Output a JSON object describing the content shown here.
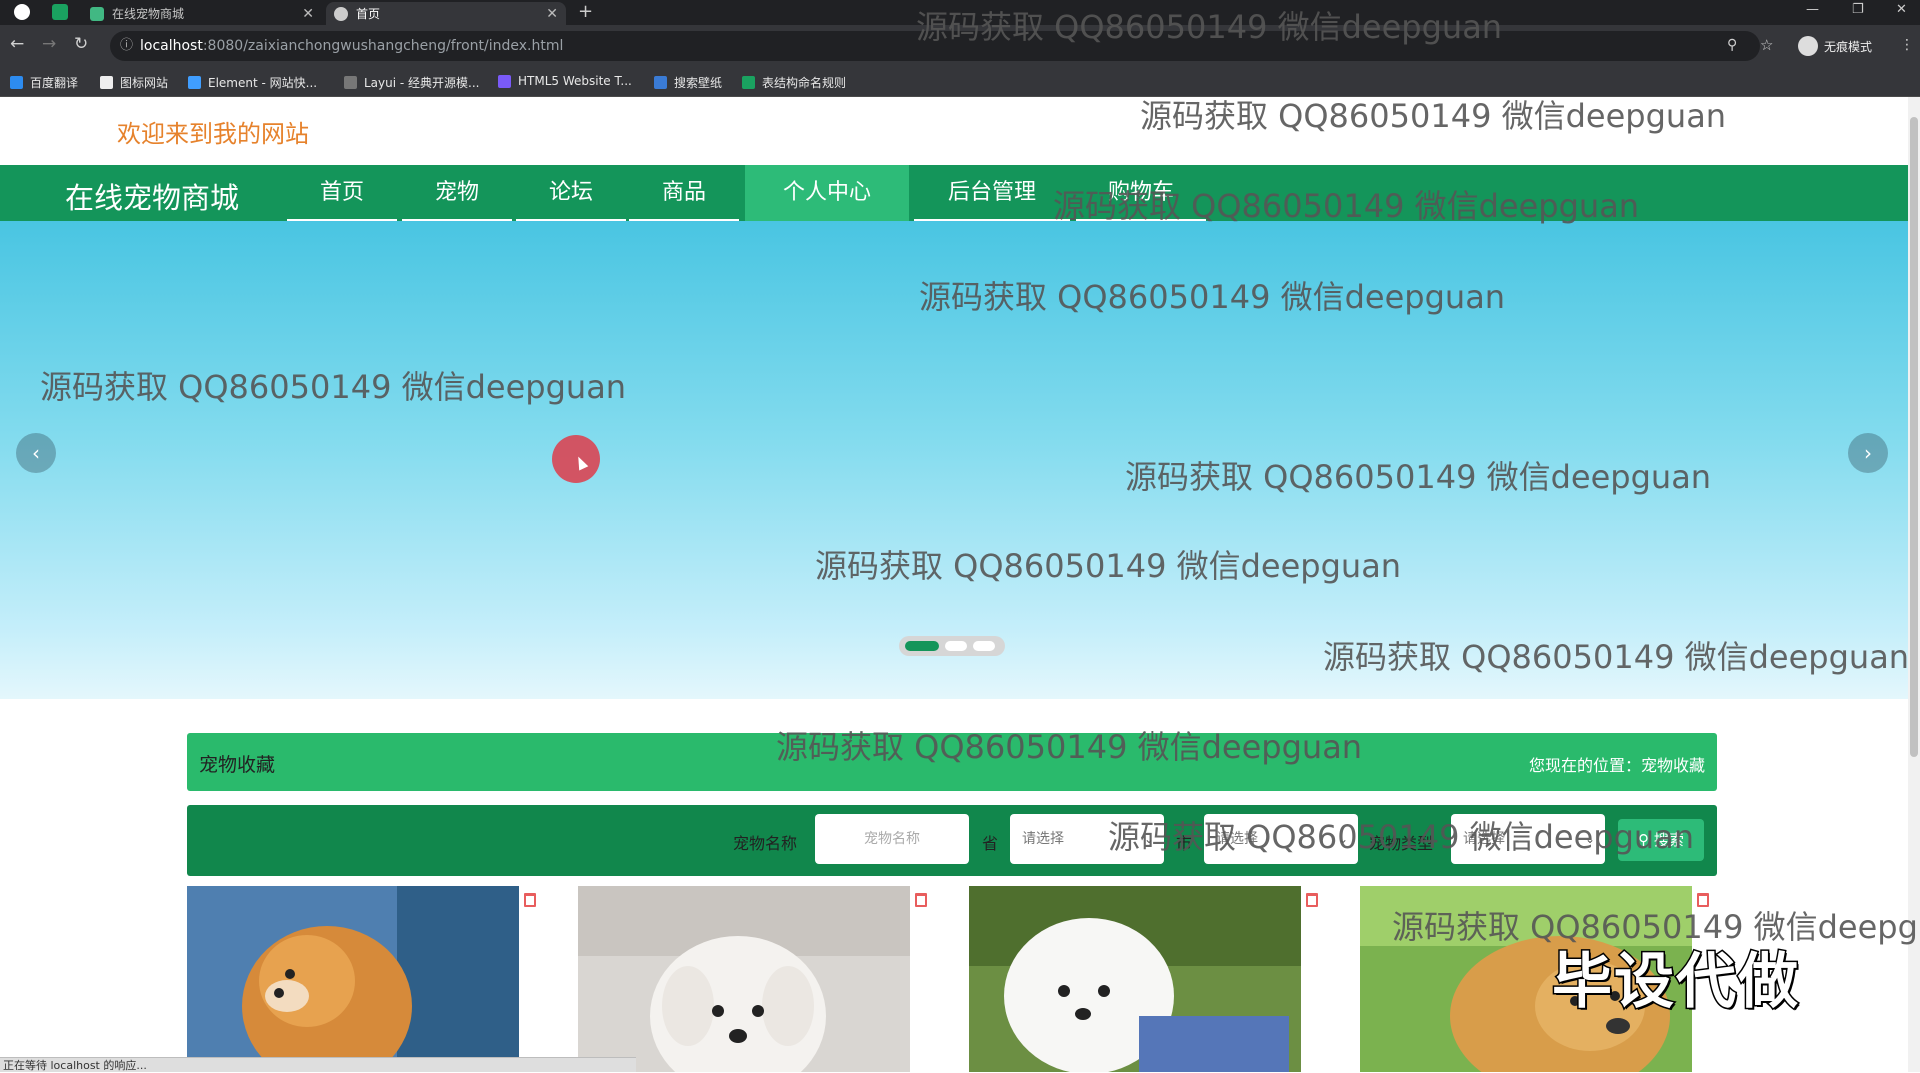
{
  "browser": {
    "tabs": [
      {
        "title": "在线宠物商城",
        "favicon": "vue-logo-icon"
      },
      {
        "title": "首页",
        "favicon": "globe-icon"
      }
    ],
    "url_host": "localhost",
    "url_path": ":8080/zaixianchongwushangcheng/front/index.html",
    "incognito_label": "无痕模式",
    "bookmarks": [
      "百度翻译",
      "图标网站",
      "Element - 网站快...",
      "Layui - 经典开源模...",
      "HTML5 Website T...",
      "搜索壁纸",
      "表结构命名规则"
    ]
  },
  "site": {
    "welcome": "欢迎来到我的网站",
    "brand": "在线宠物商城",
    "nav": [
      "首页",
      "宠物",
      "论坛",
      "商品",
      "个人中心",
      "后台管理",
      "购物车"
    ],
    "active_nav": "个人中心"
  },
  "section": {
    "title": "宠物收藏",
    "location": "您现在的位置：宠物收藏"
  },
  "search": {
    "name_label": "宠物名称",
    "name_placeholder": "宠物名称",
    "province_label": "省",
    "province_value": "请选择",
    "city_label": "市",
    "city_value": "请选择",
    "type_label": "宠物类型",
    "type_value": "请选择",
    "button": "搜索"
  },
  "overlay": {
    "badge": "毕设代做",
    "watermark": "源码获取 QQ86050149 微信deepguan",
    "status": "正在等待 localhost 的响应..."
  },
  "colors": {
    "primary": "#14955a",
    "active": "#2dbb78",
    "title_bar": "#2aba6c",
    "search_bg": "#11874c",
    "welcome": "#e6822c"
  }
}
